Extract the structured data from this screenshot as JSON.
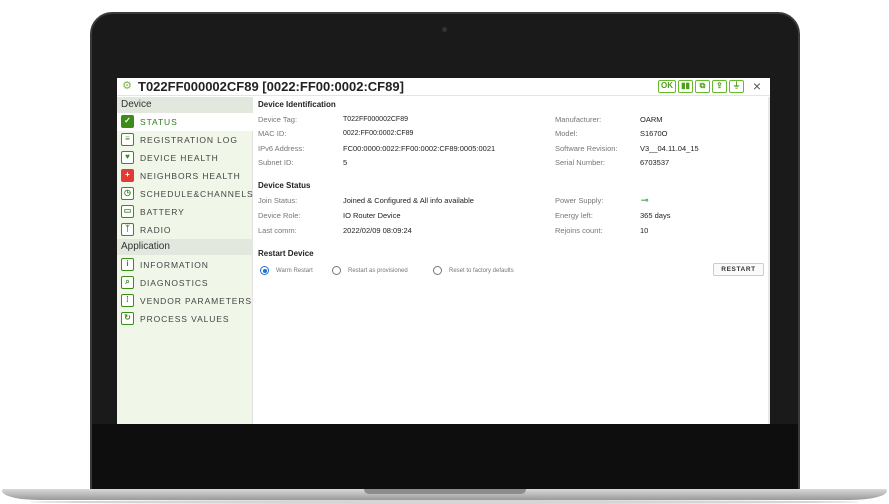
{
  "window": {
    "title": "T022FF000002CF89 [0022:FF00:0002:CF89]",
    "close_label": "×",
    "status_icons": [
      "ok-icon",
      "signal-icon",
      "copy-icon",
      "share-icon",
      "plug-icon"
    ]
  },
  "sidebar": {
    "device_header": "Device",
    "device_items": [
      {
        "label": "STATUS",
        "icon": "check-icon",
        "active": true
      },
      {
        "label": "REGISTRATION LOG",
        "icon": "log-icon"
      },
      {
        "label": "DEVICE HEALTH",
        "icon": "health-icon"
      },
      {
        "label": "NEIGHBORS HEALTH",
        "icon": "red-cross-icon"
      },
      {
        "label": "SCHEDULE&CHANNELS",
        "icon": "schedule-icon"
      },
      {
        "label": "BATTERY",
        "icon": "battery-icon"
      },
      {
        "label": "RADIO",
        "icon": "radio-icon"
      }
    ],
    "application_header": "Application",
    "application_items": [
      {
        "label": "INFORMATION",
        "icon": "info-icon"
      },
      {
        "label": "DIAGNOSTICS",
        "icon": "diagnostics-icon"
      },
      {
        "label": "VENDOR PARAMETERS",
        "icon": "parameters-icon"
      },
      {
        "label": "PROCESS VALUES",
        "icon": "process-icon"
      }
    ]
  },
  "identification": {
    "title": "Device Identification",
    "device_tag_label": "Device Tag:",
    "device_tag": "T022FF000002CF89",
    "mac_label": "MAC ID:",
    "mac": "0022:FF00:0002:CF89",
    "ipv6_label": "IPv6 Address:",
    "ipv6": "FC00:0000:0022:FF00:0002:CF89:0005:0021",
    "subnet_label": "Subnet ID:",
    "subnet": "5",
    "manufacturer_label": "Manufacturer:",
    "manufacturer": "OARM",
    "model_label": "Model:",
    "model": "S1670O",
    "software_label": "Software Revision:",
    "software": "V3__04.11.04_15",
    "serial_label": "Serial Number:",
    "serial": "6703537"
  },
  "status": {
    "title": "Device Status",
    "join_label": "Join Status:",
    "join": "Joined & Configured & All info available",
    "role_label": "Device Role:",
    "role": "IO Router Device",
    "last_comm_label": "Last comm:",
    "last_comm": "2022/02/09 08:09:24",
    "power_label": "Power Supply:",
    "energy_label": "Energy left:",
    "energy": "365 days",
    "rejoins_label": "Rejoins count:",
    "rejoins": "10"
  },
  "restart": {
    "title": "Restart Device",
    "options": [
      "Warm Restart",
      "Restart as provisioned",
      "Reset to factory defaults"
    ],
    "selected": "Warm Restart",
    "button_label": "RESTART"
  },
  "colors": {
    "accent_green": "#3d8b1a",
    "sidebar_bg": "#f0f6e8",
    "radio_blue": "#1e6fd9"
  }
}
